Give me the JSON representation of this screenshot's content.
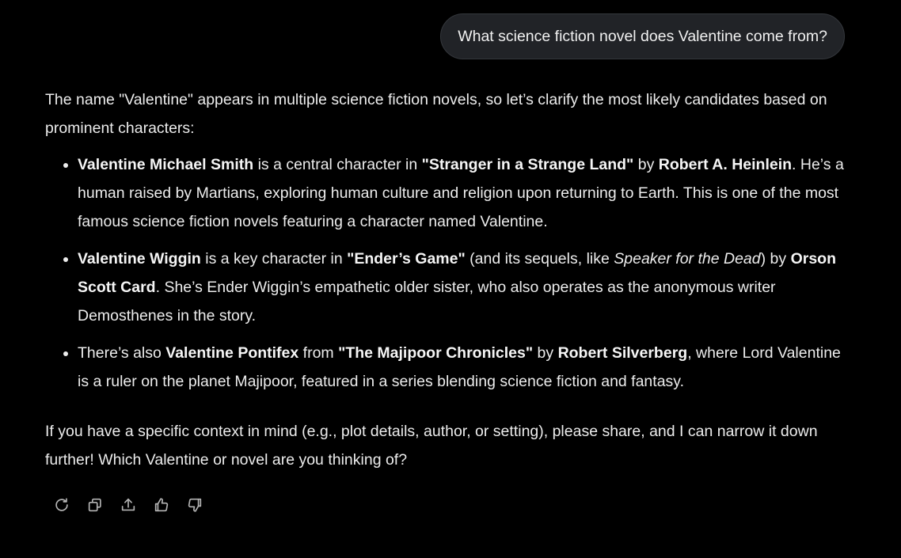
{
  "user_message": "What science fiction novel does Valentine come from?",
  "response": {
    "intro": "The name \"Valentine\" appears in multiple science fiction novels, so let’s clarify the most likely candidates based on prominent characters:",
    "items": [
      {
        "s1": "Valentine Michael Smith",
        "s2": " is a central character in ",
        "s3": "\"Stranger in a Strange Land\"",
        "s4": " by ",
        "s5": "Robert A. Heinlein",
        "s6": ". He’s a human raised by Martians, exploring human culture and religion upon returning to Earth. This is one of the most famous science fiction novels featuring a character named Valentine."
      },
      {
        "s1": "Valentine Wiggin",
        "s2": " is a key character in ",
        "s3": "\"Ender’s Game\"",
        "s4": " (and its sequels, like ",
        "s5": "Speaker for the Dead",
        "s6": ") by ",
        "s7": "Orson Scott Card",
        "s8": ". She’s Ender Wiggin’s empathetic older sister, who also operates as the anonymous writer Demosthenes in the story."
      },
      {
        "s1": "There’s also ",
        "s2": "Valentine Pontifex",
        "s3": " from ",
        "s4": "\"The Majipoor Chronicles\"",
        "s5": " by ",
        "s6": "Robert Silverberg",
        "s7": ", where Lord Valentine is a ruler on the planet Majipoor, featured in a series blending science fiction and fantasy."
      }
    ],
    "closing": "If you have a specific context in mind (e.g., plot details, author, or setting), please share, and I can narrow it down further! Which Valentine or novel are you thinking of?"
  },
  "actions": [
    {
      "icon": "regenerate-icon"
    },
    {
      "icon": "copy-icon"
    },
    {
      "icon": "share-icon"
    },
    {
      "icon": "thumbs-up-icon"
    },
    {
      "icon": "thumbs-down-icon"
    }
  ],
  "colors": {
    "background": "#000000",
    "bubble": "#212327",
    "text": "#ececec",
    "icon": "#b5b5b5"
  }
}
